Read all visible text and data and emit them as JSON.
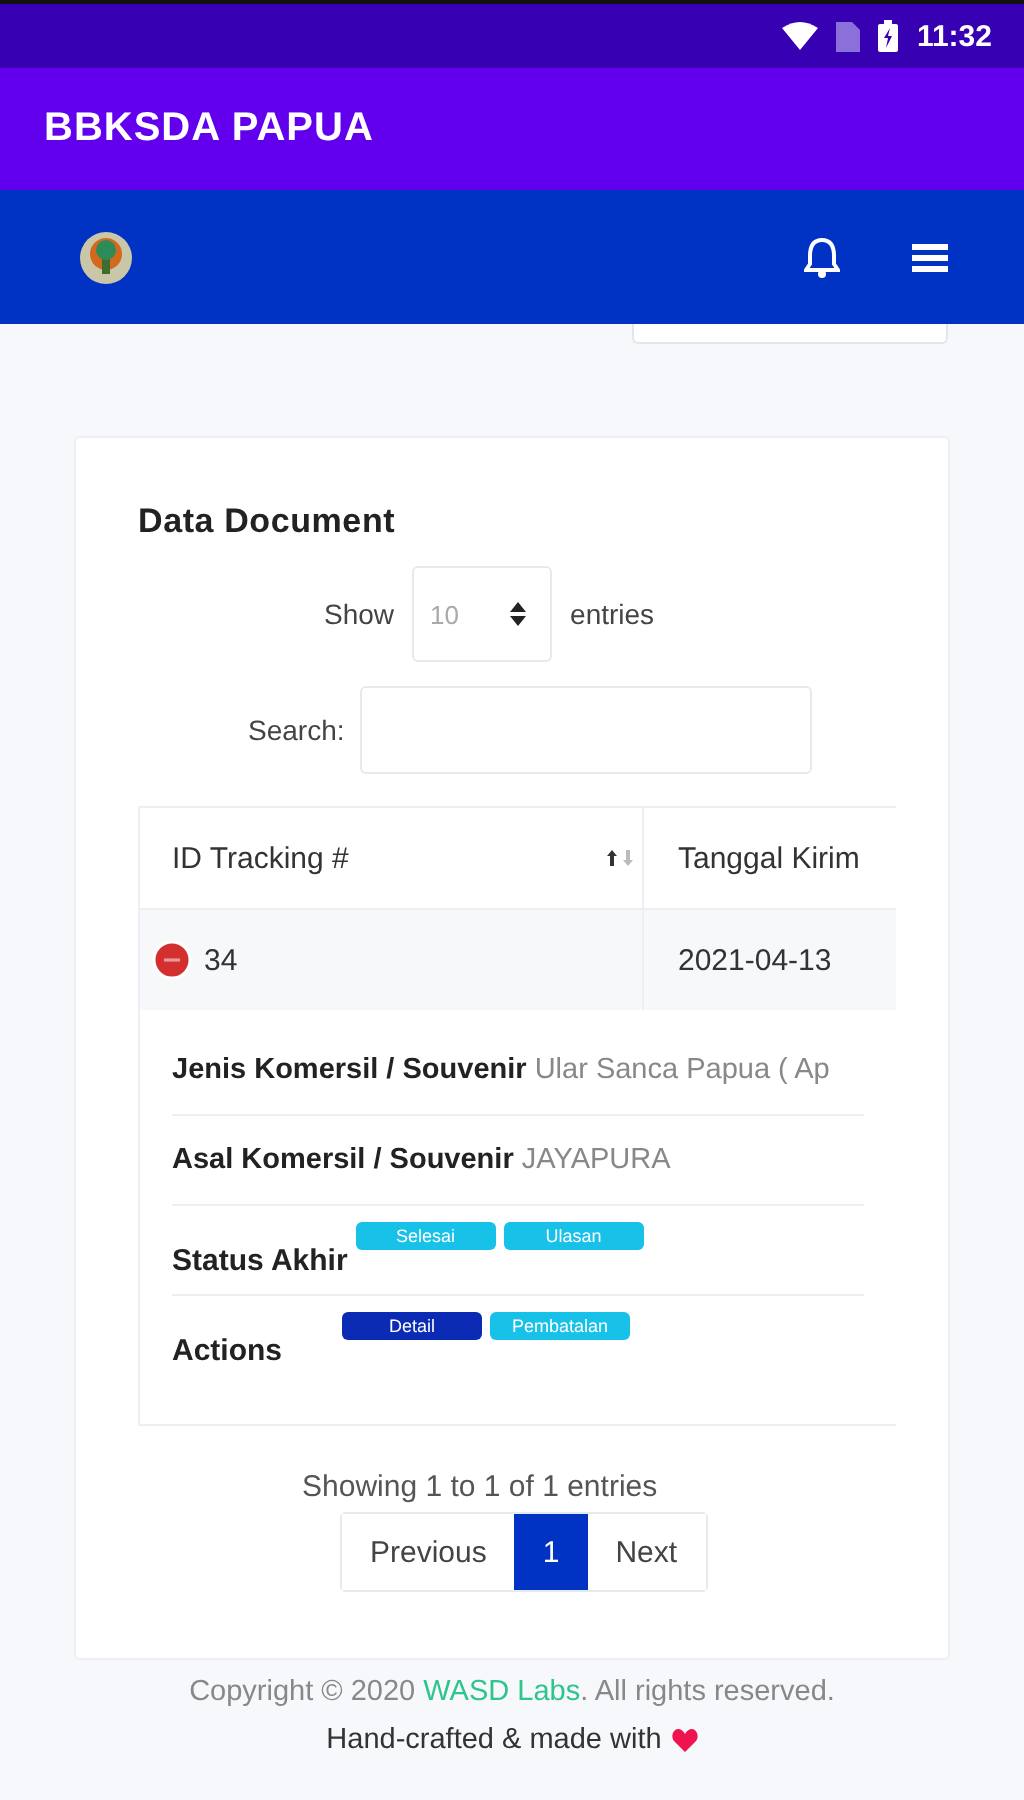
{
  "status_bar": {
    "time": "11:32"
  },
  "app_bar": {
    "title": "BBKSDA PAPUA"
  },
  "card": {
    "title": "Data Document",
    "length": {
      "before": "Show",
      "value": "10",
      "after": "entries"
    },
    "search": {
      "label": "Search:"
    },
    "table": {
      "columns": [
        {
          "label": "ID Tracking #",
          "sortable": true
        },
        {
          "label": "Tanggal Kirim",
          "sortable": false
        }
      ],
      "rows": [
        {
          "expanded": true,
          "cells": [
            "34",
            "2021-04-13"
          ],
          "details": [
            {
              "kind": "text",
              "label": "Jenis Komersil / Souvenir",
              "value": "Ular Sanca Papua ( Ap"
            },
            {
              "kind": "text",
              "label": "Asal Komersil / Souvenir",
              "value": "JAYAPURA"
            },
            {
              "kind": "badges",
              "label": "Status Akhir",
              "badges": [
                {
                  "label": "Selesai",
                  "color": "#17c1e8"
                },
                {
                  "label": "Ulasan",
                  "color": "#17c1e8"
                }
              ]
            },
            {
              "kind": "badges",
              "label": "Actions",
              "badges": [
                {
                  "label": "Detail",
                  "color": "#0b2bb5"
                },
                {
                  "label": "Pembatalan",
                  "color": "#17c1e8"
                }
              ]
            }
          ]
        }
      ]
    },
    "info": "Showing 1 to 1 of 1 entries",
    "pagination": [
      {
        "label": "Previous",
        "selected": false
      },
      {
        "label": "1",
        "selected": true
      },
      {
        "label": "Next",
        "selected": false
      }
    ]
  },
  "footer": {
    "copyright": {
      "before": "Copyright © 2020 ",
      "link": "WASD Labs",
      "after": ". All rights reserved."
    },
    "credit": "Hand-crafted & made with"
  }
}
